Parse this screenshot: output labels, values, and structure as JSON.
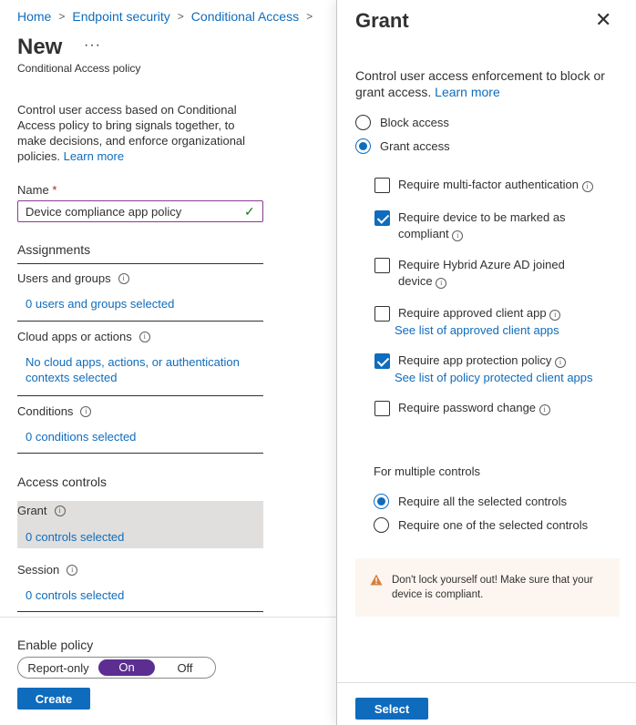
{
  "breadcrumb": [
    "Home",
    "Endpoint security",
    "Conditional Access"
  ],
  "page": {
    "title": "New",
    "more": "···",
    "subtitle": "Conditional Access policy",
    "description": "Control user access based on Conditional Access policy to bring signals together, to make decisions, and enforce organizational policies.",
    "learn_more": "Learn more"
  },
  "name_field": {
    "label": "Name",
    "required_mark": "*",
    "value": "Device compliance app policy"
  },
  "assignments": {
    "heading": "Assignments",
    "users": {
      "label": "Users and groups",
      "value": "0 users and groups selected"
    },
    "cloud_apps": {
      "label": "Cloud apps or actions",
      "value": "No cloud apps, actions, or authentication contexts selected"
    },
    "conditions": {
      "label": "Conditions",
      "value": "0 conditions selected"
    }
  },
  "access_controls": {
    "heading": "Access controls",
    "grant": {
      "label": "Grant",
      "value": "0 controls selected"
    },
    "session": {
      "label": "Session",
      "value": "0 controls selected"
    }
  },
  "enable_policy": {
    "label": "Enable policy",
    "options": [
      "Report-only",
      "On",
      "Off"
    ],
    "selected": "On"
  },
  "create_label": "Create",
  "grant_panel": {
    "title": "Grant",
    "close": "✕",
    "description": "Control user access enforcement to block or grant access.",
    "learn_more": "Learn more",
    "access_options": [
      {
        "label": "Block access",
        "selected": false
      },
      {
        "label": "Grant access",
        "selected": true
      }
    ],
    "controls": [
      {
        "label": "Require multi-factor authentication",
        "checked": false
      },
      {
        "label": "Require device to be marked as compliant",
        "checked": true
      },
      {
        "label": "Require Hybrid Azure AD joined device",
        "checked": false
      },
      {
        "label": "Require approved client app",
        "checked": false,
        "link": "See list of approved client apps"
      },
      {
        "label": "Require app protection policy",
        "checked": true,
        "link": "See list of policy protected client apps"
      },
      {
        "label": "Require password change",
        "checked": false
      }
    ],
    "multiple_label": "For multiple controls",
    "multiple_options": [
      {
        "label": "Require all the selected controls",
        "selected": true
      },
      {
        "label": "Require one of the selected controls",
        "selected": false
      }
    ],
    "warning": "Don't lock yourself out! Make sure that your device is compliant.",
    "select_label": "Select"
  },
  "colors": {
    "link": "#0f6cbd",
    "toggle_on": "#5c2e91",
    "warning_icon": "#d67f3c"
  }
}
